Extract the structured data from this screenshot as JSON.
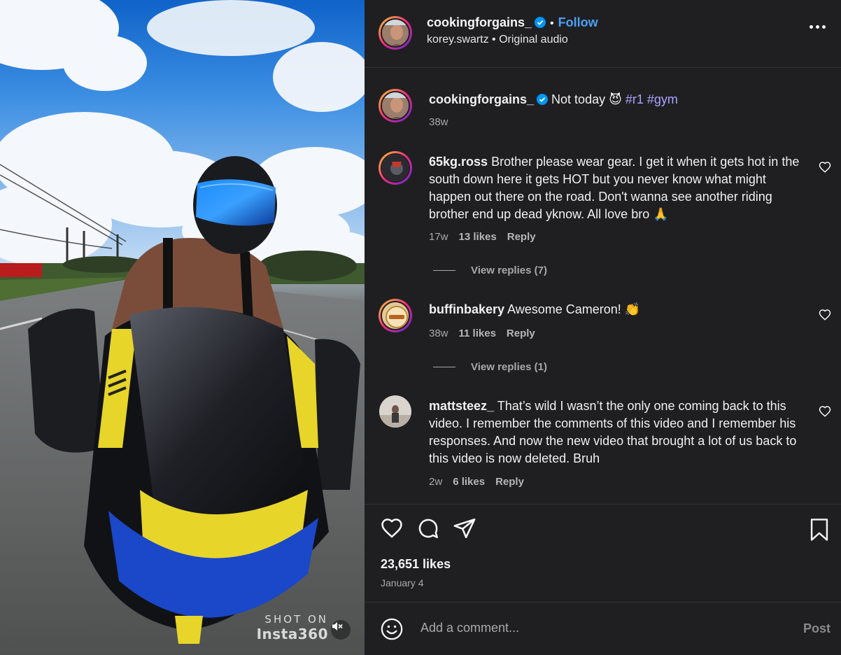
{
  "video": {
    "watermark_top": "SHOT ON",
    "watermark_bottom": "Insta360",
    "mute_icon": "speaker-muted-icon"
  },
  "header": {
    "username": "cookingforgains_",
    "verified": true,
    "separator": "•",
    "follow_label": "Follow",
    "audio_line": "korey.swartz • Original audio",
    "more_icon": "more-options-icon"
  },
  "caption": {
    "username": "cookingforgains_",
    "text": "Not today 😈",
    "hashtags": "#r1 #gym",
    "time": "38w"
  },
  "comments": [
    {
      "username": "65kg.ross",
      "text": "Brother please wear gear. I get it when it gets hot in the south down here it gets HOT but you never know what might happen out there on the road. Don't wanna see another riding brother end up dead yknow. All love bro 🙏",
      "time": "17w",
      "likes": "13 likes",
      "reply": "Reply",
      "view_replies": "View replies (7)"
    },
    {
      "username": "buffinbakery",
      "text": "Awesome Cameron! 👏",
      "time": "38w",
      "likes": "11 likes",
      "reply": "Reply",
      "view_replies": "View replies (1)"
    },
    {
      "username": "mattsteez_",
      "text": "That’s wild I wasn’t the only one coming back to this video. I remember the comments of this video and I remember his responses. And now the new video that brought a lot of us back to this video is now deleted. Bruh",
      "time": "2w",
      "likes": "6 likes",
      "reply": "Reply"
    }
  ],
  "footer": {
    "likes": "23,651 likes",
    "date": "January 4",
    "add_comment_placeholder": "Add a comment...",
    "post_label": "Post"
  },
  "colors": {
    "panel_bg": "#1f1f22",
    "link_blue": "#4c9ff5",
    "hashtag": "#a9a4ff",
    "verified_blue": "#0095f6",
    "muted_text": "#a8a8a8"
  }
}
